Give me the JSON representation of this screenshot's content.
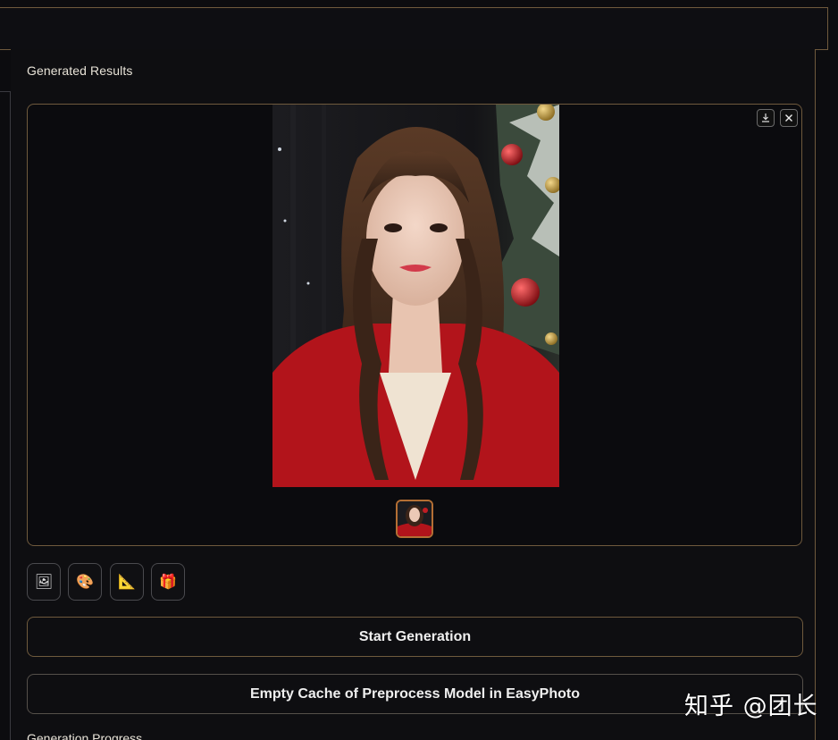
{
  "section": {
    "title": "Generated Results"
  },
  "gallery": {
    "download_icon": "download-icon",
    "close_icon": "close-icon",
    "selected_thumbnail_index": 0
  },
  "tools": [
    {
      "icon": "image-icon",
      "glyph": "🖼"
    },
    {
      "icon": "palette-icon",
      "glyph": "🎨"
    },
    {
      "icon": "triangle-ruler-icon",
      "glyph": "📐"
    },
    {
      "icon": "gift-icon",
      "glyph": "🎁"
    }
  ],
  "buttons": {
    "start_label": "Start Generation",
    "empty_cache_label": "Empty Cache of Preprocess Model in EasyPhoto"
  },
  "progress": {
    "label": "Generation Progress"
  },
  "watermark": {
    "text": "知乎 @团长"
  },
  "colors": {
    "accent_border": "#6f5a3d",
    "thumb_border": "#b46f34",
    "background": "#0c0c0f"
  }
}
